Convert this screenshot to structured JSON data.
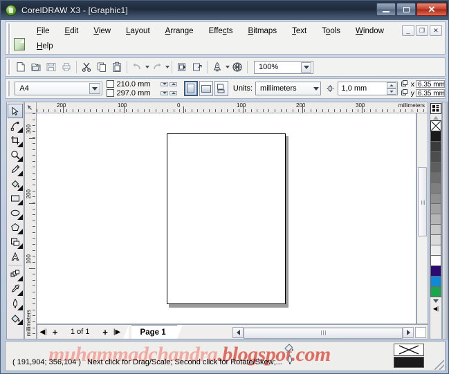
{
  "window": {
    "title": "CorelDRAW X3 - [Graphic1]",
    "app_icon": "coreldraw-balloon-icon",
    "buttons": {
      "minimize": "minimize-icon",
      "maximize": "maximize-icon",
      "close": "close-icon"
    }
  },
  "menu": {
    "row1": [
      {
        "label": "File",
        "accel": "F"
      },
      {
        "label": "Edit",
        "accel": "E"
      },
      {
        "label": "View",
        "accel": "V"
      },
      {
        "label": "Layout",
        "accel": "L"
      },
      {
        "label": "Arrange",
        "accel": "A"
      },
      {
        "label": "Effects",
        "accel": "c"
      },
      {
        "label": "Bitmaps",
        "accel": "B"
      },
      {
        "label": "Text",
        "accel": "T"
      },
      {
        "label": "Tools",
        "accel": "o"
      },
      {
        "label": "Window",
        "accel": "W"
      }
    ],
    "row2": [
      {
        "label": "Help",
        "accel": "H"
      }
    ],
    "mdi_buttons": [
      "restore-down-icon",
      "maximize-icon",
      "close-icon"
    ]
  },
  "toolbar": {
    "items": [
      {
        "name": "new-button",
        "icon": "new-document-icon"
      },
      {
        "name": "open-button",
        "icon": "open-folder-icon"
      },
      {
        "name": "save-button",
        "icon": "save-disk-icon"
      },
      {
        "name": "print-button",
        "icon": "printer-icon"
      },
      {
        "name": "cut-button",
        "icon": "scissors-icon"
      },
      {
        "name": "copy-button",
        "icon": "copy-icon"
      },
      {
        "name": "paste-button",
        "icon": "clipboard-paste-icon"
      },
      {
        "name": "undo-button",
        "icon": "undo-arrow-icon"
      },
      {
        "name": "redo-button",
        "icon": "redo-arrow-icon"
      },
      {
        "name": "import-button",
        "icon": "import-icon"
      },
      {
        "name": "export-button",
        "icon": "export-icon"
      },
      {
        "name": "application-launcher-button",
        "icon": "rocket-icon"
      },
      {
        "name": "corel-online-button",
        "icon": "globe-web-icon"
      }
    ],
    "zoom_level": "100%",
    "zoom_dropdown_icon": "chevron-down-icon"
  },
  "property_bar": {
    "paper_type": "A4",
    "paper_dropdown_icon": "chevron-down-icon",
    "page_width": "210.0 mm",
    "page_height": "297.0 mm",
    "width_icon": "page-width-icon",
    "height_icon": "page-height-icon",
    "orientation_portrait_icon": "portrait-page-icon",
    "orientation_landscape_icon": "landscape-page-icon",
    "selected_orientation": "portrait",
    "page_toggle_icon": "all-pages-icon",
    "units_label": "Units:",
    "units_value": "millimeters",
    "units_dropdown_icon": "chevron-down-icon",
    "nudge_icon": "nudge-offset-icon",
    "nudge_value": "1,0 mm",
    "duplicate_x_label": "x",
    "duplicate_y_label": "y",
    "duplicate_x_value": "6.35 mm",
    "duplicate_y_value": "6.35 mm",
    "duplicate_x_icon": "duplicate-x-icon",
    "duplicate_y_icon": "duplicate-y-icon"
  },
  "rulers": {
    "corner_icon": "ruler-origin-icon",
    "horizontal_labels": [
      "200",
      "100",
      "0",
      "100",
      "200",
      "300"
    ],
    "horizontal_unit": "millimeters",
    "vertical_labels": [
      "300",
      "200",
      "100"
    ],
    "vertical_unit": "millimeters"
  },
  "toolbox": [
    {
      "name": "pick-tool",
      "icon": "arrow-cursor-icon",
      "active": true,
      "flyout": false
    },
    {
      "name": "shape-tool",
      "icon": "shape-node-icon",
      "active": false,
      "flyout": true
    },
    {
      "name": "crop-tool",
      "icon": "crop-icon",
      "active": false,
      "flyout": true
    },
    {
      "name": "zoom-tool",
      "icon": "magnifier-icon",
      "active": false,
      "flyout": true
    },
    {
      "name": "freehand-tool",
      "icon": "pencil-icon",
      "active": false,
      "flyout": true
    },
    {
      "name": "smart-fill-tool",
      "icon": "paint-bucket-icon",
      "active": false,
      "flyout": true
    },
    {
      "name": "rectangle-tool",
      "icon": "rectangle-icon",
      "active": false,
      "flyout": true
    },
    {
      "name": "ellipse-tool",
      "icon": "ellipse-icon",
      "active": false,
      "flyout": true
    },
    {
      "name": "polygon-tool",
      "icon": "polygon-icon",
      "active": false,
      "flyout": true
    },
    {
      "name": "basic-shapes-tool",
      "icon": "basic-shapes-icon",
      "active": false,
      "flyout": true
    },
    {
      "name": "text-tool",
      "icon": "text-a-icon",
      "active": false,
      "flyout": false
    },
    {
      "name": "blend-tool",
      "icon": "interactive-blend-icon",
      "active": false,
      "flyout": true
    },
    {
      "name": "eyedropper-tool",
      "icon": "eyedropper-icon",
      "active": false,
      "flyout": true
    },
    {
      "name": "outline-tool",
      "icon": "outline-pen-icon",
      "active": false,
      "flyout": true
    },
    {
      "name": "fill-tool",
      "icon": "fill-icon",
      "active": false,
      "flyout": true
    }
  ],
  "palette": {
    "top_icon": "palette-menu-icon",
    "scroll_up_icon": "scroll-up-arrow-icon",
    "scroll_down_icon": "scroll-down-arrow-icon",
    "scroll_start_icon": "scroll-to-start-icon",
    "no_color_icon": "no-color-x-icon",
    "swatches": [
      "#1a1a1a",
      "#3b3b3b",
      "#4d4d4d",
      "#5e5e5e",
      "#6e6e6e",
      "#7f7f7f",
      "#909090",
      "#a2a2a2",
      "#b5b5b5",
      "#c8c8c8",
      "#dadada",
      "#ededed",
      "#ffffff",
      "#2c0a72",
      "#1288d8",
      "#19a64e"
    ]
  },
  "canvas": {
    "page_label": "drawing-page"
  },
  "page_navigator": {
    "first_page_icon": "first-page-icon",
    "add_page_before_icon": "add-page-icon",
    "page_counter": "1 of 1",
    "add_page_after_icon": "add-page-icon",
    "last_page_icon": "last-page-icon",
    "tabs": [
      {
        "label": "Page 1",
        "active": true
      }
    ],
    "scroll_left_icon": "scroll-left-arrow-icon",
    "scroll_right_icon": "scroll-right-arrow-icon",
    "scroll_thumb_icon": "scrollbar-grip-icon"
  },
  "status_bar": {
    "coordinates": "( 191,904; 356,104 )",
    "hint": "Next click for Drag/Scale; Second click for Rotate/Skew;...",
    "fill_swatch_icon": "no-fill-x-icon",
    "outline_swatch_color": "#1b1b1b",
    "watermark_light": "muhammadchandra",
    "watermark_dark": ".blogspot.com"
  }
}
